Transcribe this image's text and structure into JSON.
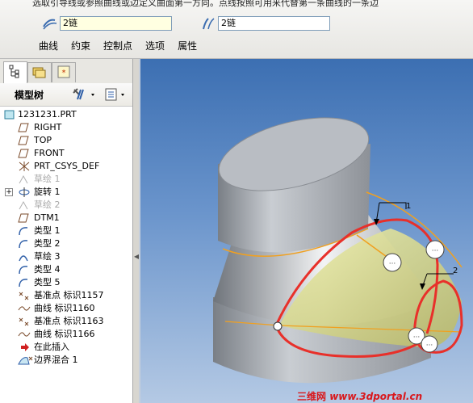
{
  "dashboard": {
    "hint": "选取引导线或参照曲线或边定义曲面第一方向。点线按照可用来代替第一条曲线的一条边",
    "chain_field_1": "2链",
    "chain_field_2": "2链",
    "tabs": [
      "曲线",
      "约束",
      "控制点",
      "选项",
      "属性"
    ]
  },
  "model_tree": {
    "title": "模型树",
    "items": [
      {
        "label": "1231231.PRT",
        "icon": "part-icon",
        "enabled": true
      },
      {
        "label": "RIGHT",
        "icon": "datum-plane-icon",
        "enabled": true
      },
      {
        "label": "TOP",
        "icon": "datum-plane-icon",
        "enabled": true
      },
      {
        "label": "FRONT",
        "icon": "datum-plane-icon",
        "enabled": true
      },
      {
        "label": "PRT_CSYS_DEF",
        "icon": "csys-icon",
        "enabled": true
      },
      {
        "label": "草绘 1",
        "icon": "sketch-icon",
        "enabled": false
      },
      {
        "label": "旋转 1",
        "icon": "revolve-icon",
        "enabled": true
      },
      {
        "label": "草绘 2",
        "icon": "sketch-icon",
        "enabled": false
      },
      {
        "label": "DTM1",
        "icon": "datum-plane-icon",
        "enabled": true
      },
      {
        "label": "类型 1",
        "icon": "curve-type-icon",
        "enabled": true
      },
      {
        "label": "类型 2",
        "icon": "curve-type-icon",
        "enabled": true
      },
      {
        "label": "草绘 3",
        "icon": "sketch-icon",
        "enabled": true
      },
      {
        "label": "类型 4",
        "icon": "curve-type-icon",
        "enabled": true
      },
      {
        "label": "类型 5",
        "icon": "curve-type-icon",
        "enabled": true
      },
      {
        "label": "基准点 标识1157",
        "icon": "datum-point-icon",
        "enabled": true
      },
      {
        "label": "曲线 标识1160",
        "icon": "curve-icon",
        "enabled": true
      },
      {
        "label": "基准点 标识1163",
        "icon": "datum-point-icon",
        "enabled": true
      },
      {
        "label": "曲线 标识1166",
        "icon": "curve-icon",
        "enabled": true
      },
      {
        "label": "在此插入",
        "icon": "insert-arrow-icon",
        "enabled": true
      },
      {
        "label": "边界混合 1",
        "icon": "boundary-blend-icon",
        "enabled": true
      }
    ]
  },
  "viewport": {
    "callouts": [
      "1",
      "2"
    ]
  },
  "watermark": {
    "cn": "三维网",
    "url": "www.3dportal.cn"
  },
  "colors": {
    "viewport_top": "#3c6fb2",
    "viewport_bottom": "#b4c9e4",
    "highlight_curve": "#e8302a",
    "surface": "#d9da86",
    "edge": "#f0a020"
  }
}
